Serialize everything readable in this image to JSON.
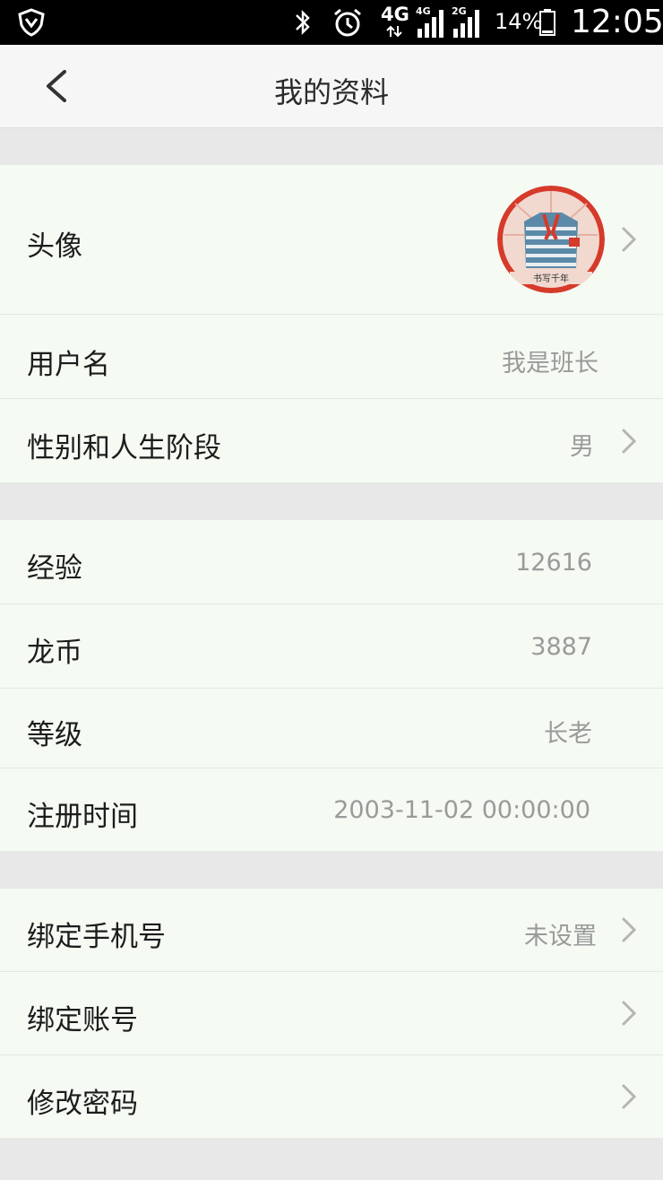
{
  "status_bar": {
    "network_4g": "4G",
    "signal1_tag": "4G",
    "signal2_tag": "2G",
    "battery": "14%",
    "time": "12:05"
  },
  "header": {
    "title": "我的资料"
  },
  "profile": {
    "avatar_label": "头像",
    "avatar_caption": "书写千年",
    "username_label": "用户名",
    "username_value": "我是班长",
    "gender_label": "性别和人生阶段",
    "gender_value": "男"
  },
  "stats": {
    "exp_label": "经验",
    "exp_value": "12616",
    "coins_label": "龙币",
    "coins_value": "3887",
    "level_label": "等级",
    "level_value": "长老",
    "reg_label": "注册时间",
    "reg_value": "2003-11-02 00:00:00"
  },
  "account": {
    "phone_label": "绑定手机号",
    "phone_value": "未设置",
    "bind_label": "绑定账号",
    "password_label": "修改密码"
  },
  "colors": {
    "section_bg": "#f5faf3",
    "page_bg": "#e8e8e8",
    "value_text": "#9a9a9a"
  }
}
